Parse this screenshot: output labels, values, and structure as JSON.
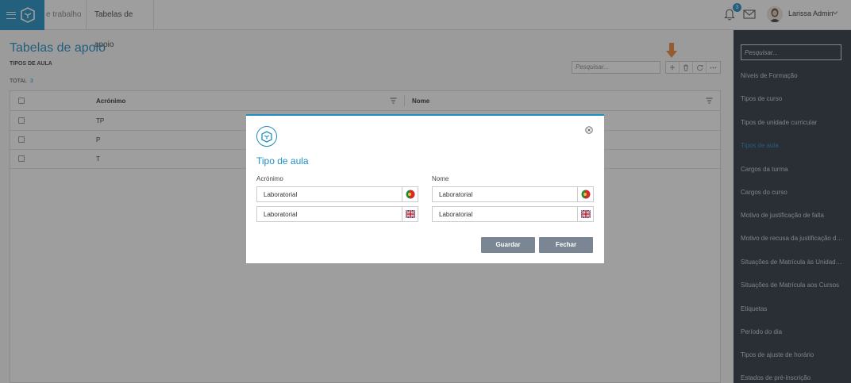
{
  "topbar": {
    "crumbs": [
      "e trabalho",
      "Tabelas de apoio"
    ],
    "notifications_count": "3",
    "user_name": "Larissa Admin"
  },
  "page": {
    "title": "Tabelas de apoio",
    "section": "TIPOS DE AULA",
    "total_label": "TOTAL",
    "total_count": "3",
    "search_placeholder": "Pesquisar..."
  },
  "grid": {
    "columns": [
      "Acrónimo",
      "Nome"
    ],
    "rows": [
      {
        "acronimo": "TP",
        "nome": ""
      },
      {
        "acronimo": "P",
        "nome": ""
      },
      {
        "acronimo": "T",
        "nome": ""
      }
    ]
  },
  "sidebar": {
    "search_placeholder": "Pesquisar...",
    "items": [
      {
        "label": "Níveis de Formação",
        "active": false
      },
      {
        "label": "Tipos de curso",
        "active": false
      },
      {
        "label": "Tipos de unidade curricular",
        "active": false
      },
      {
        "label": "Tipos de aula",
        "active": true
      },
      {
        "label": "Cargos da turma",
        "active": false
      },
      {
        "label": "Cargos do curso",
        "active": false
      },
      {
        "label": "Motivo de justificação de falta",
        "active": false
      },
      {
        "label": "Motivo de recusa da justificação de falta",
        "active": false
      },
      {
        "label": "Situações de Matrícula às Unidades Cu...",
        "active": false
      },
      {
        "label": "Situações de Matrícula aos Cursos",
        "active": false
      },
      {
        "label": "Etiquetas",
        "active": false
      },
      {
        "label": "Período do dia",
        "active": false
      },
      {
        "label": "Tipos de ajuste de horário",
        "active": false
      },
      {
        "label": "Estados de pré-inscrição",
        "active": false
      }
    ]
  },
  "modal": {
    "title": "Tipo de aula",
    "acronimo_label": "Acrónimo",
    "nome_label": "Nome",
    "acronimo_pt": "Laboratorial",
    "acronimo_en": "Laboratorial",
    "nome_pt": "Laboratorial",
    "nome_en": "Laboratorial",
    "save_label": "Guardar",
    "close_label": "Fechar"
  },
  "colors": {
    "accent": "#1e8ec4",
    "sidebar_bg": "#2c3440",
    "button_gray": "#7a8694",
    "hint_arrow": "#f0883a"
  },
  "icons": [
    "menu-icon",
    "app-logo-icon",
    "bell-icon",
    "mail-icon",
    "chevron-down-icon",
    "plus-icon",
    "trash-icon",
    "refresh-icon",
    "more-icon",
    "filter-icon",
    "close-circle-icon",
    "portugal-flag-icon",
    "uk-flag-icon"
  ]
}
